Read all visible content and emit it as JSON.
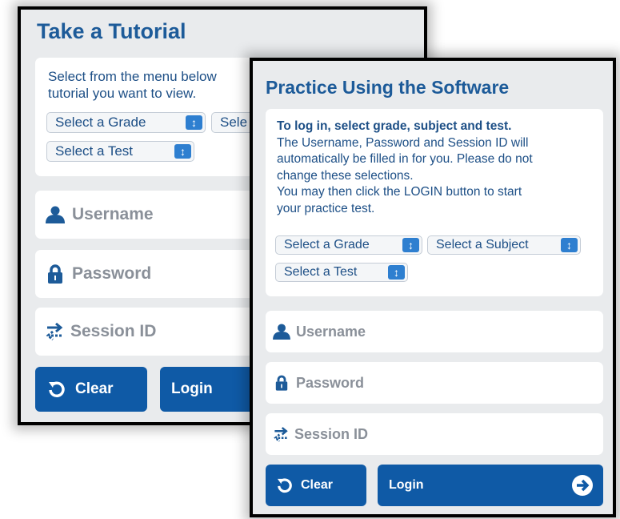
{
  "tutorial": {
    "title": "Take a Tutorial",
    "instructions_line1": "Select from the menu below",
    "instructions_line2": "tutorial you want to view.",
    "grade_select": "Select a Grade",
    "subject_select_partial": "Sele",
    "test_select": "Select a Test",
    "username_placeholder": "Username",
    "password_placeholder": "Password",
    "session_placeholder": "Session ID",
    "clear_label": "Clear",
    "login_label": "Login"
  },
  "practice": {
    "title": "Practice Using the Software",
    "instructions_bold": "To log in, select grade, subject and test.",
    "instructions_l1": "The Username, Password and Session ID will",
    "instructions_l2": "automatically be filled in for you. Please do not",
    "instructions_l3": "change these selections.",
    "instructions_l4": "You may then click the LOGIN button to start",
    "instructions_l5": "your practice test.",
    "grade_select": "Select a Grade",
    "subject_select": "Select a Subject",
    "test_select": "Select a Test",
    "username_placeholder": "Username",
    "password_placeholder": "Password",
    "session_placeholder": "Session ID",
    "clear_label": "Clear",
    "login_label": "Login"
  },
  "icons": {
    "user": "user-icon",
    "lock": "lock-icon",
    "session": "swap-arrows-icon",
    "refresh": "refresh-icon",
    "arrow": "arrow-right-circle-icon",
    "updown": "up-down-arrow-icon"
  },
  "colors": {
    "title": "#1d5b99",
    "button": "#0f5aa6",
    "select_arrow": "#2e7fd0",
    "panel_bg": "#e9ebed"
  }
}
